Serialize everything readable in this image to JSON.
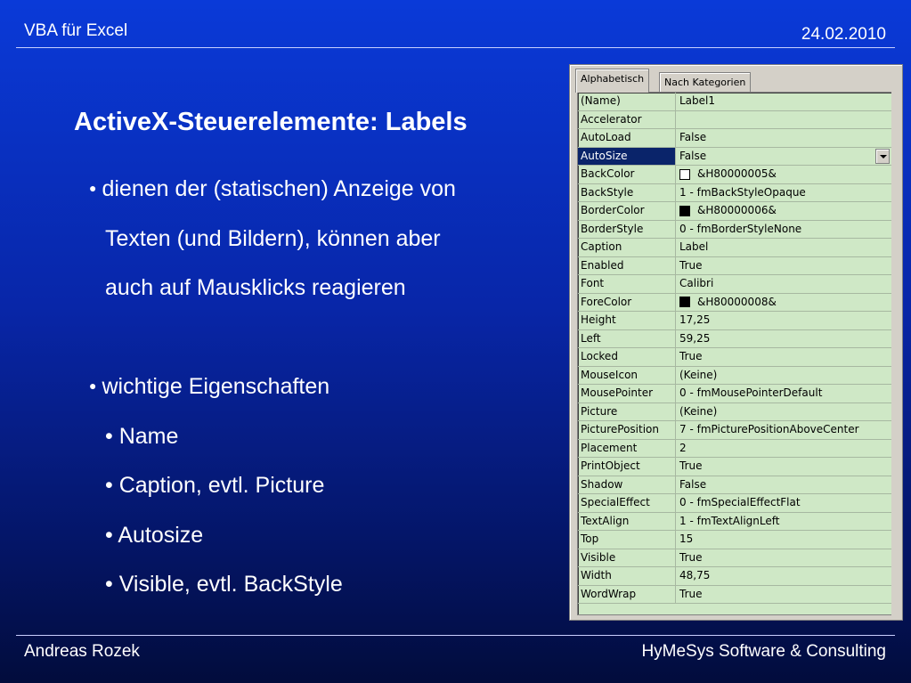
{
  "header": {
    "left": "VBA für Excel",
    "right": "24.02.2010"
  },
  "footer": {
    "left": "Andreas Rozek",
    "right": "HyMeSys Software & Consulting"
  },
  "slide": {
    "title": "ActiveX-Steuerelemente: Labels",
    "bullet1": [
      "dienen der (statischen) Anzeige von",
      "Texten (und Bildern), können aber",
      "auch auf Mausklicks reagieren"
    ],
    "bullet2": "wichtige Eigenschaften",
    "sub": [
      "• Name",
      "• Caption, evtl. Picture",
      "• Autosize",
      "• Visible, evtl. BackStyle"
    ]
  },
  "properties_window": {
    "tabs": [
      "Alphabetisch",
      "Nach Kategorien"
    ],
    "active_tab": "Alphabetisch",
    "selected_row": "AutoSize",
    "rows": [
      {
        "name": "(Name)",
        "value": "Label1"
      },
      {
        "name": "Accelerator",
        "value": ""
      },
      {
        "name": "AutoLoad",
        "value": "False"
      },
      {
        "name": "AutoSize",
        "value": "False"
      },
      {
        "name": "BackColor",
        "value": "&H80000005&",
        "swatch": "white"
      },
      {
        "name": "BackStyle",
        "value": "1 - fmBackStyleOpaque"
      },
      {
        "name": "BorderColor",
        "value": "&H80000006&",
        "swatch": "black"
      },
      {
        "name": "BorderStyle",
        "value": "0 - fmBorderStyleNone"
      },
      {
        "name": "Caption",
        "value": "Label"
      },
      {
        "name": "Enabled",
        "value": "True"
      },
      {
        "name": "Font",
        "value": "Calibri"
      },
      {
        "name": "ForeColor",
        "value": "&H80000008&",
        "swatch": "black"
      },
      {
        "name": "Height",
        "value": "17,25"
      },
      {
        "name": "Left",
        "value": "59,25"
      },
      {
        "name": "Locked",
        "value": "True"
      },
      {
        "name": "MouseIcon",
        "value": "(Keine)"
      },
      {
        "name": "MousePointer",
        "value": "0 - fmMousePointerDefault"
      },
      {
        "name": "Picture",
        "value": "(Keine)"
      },
      {
        "name": "PicturePosition",
        "value": "7 - fmPicturePositionAboveCenter"
      },
      {
        "name": "Placement",
        "value": "2"
      },
      {
        "name": "PrintObject",
        "value": "True"
      },
      {
        "name": "Shadow",
        "value": "False"
      },
      {
        "name": "SpecialEffect",
        "value": "0 - fmSpecialEffectFlat"
      },
      {
        "name": "TextAlign",
        "value": "1 - fmTextAlignLeft"
      },
      {
        "name": "Top",
        "value": "15"
      },
      {
        "name": "Visible",
        "value": "True"
      },
      {
        "name": "Width",
        "value": "48,75"
      },
      {
        "name": "WordWrap",
        "value": "True"
      }
    ]
  },
  "colors": {
    "background_top": "#0a3ad8",
    "background_bottom": "#020c3c",
    "grid_background": "#cfe8c6",
    "selection": "#0a246a"
  }
}
